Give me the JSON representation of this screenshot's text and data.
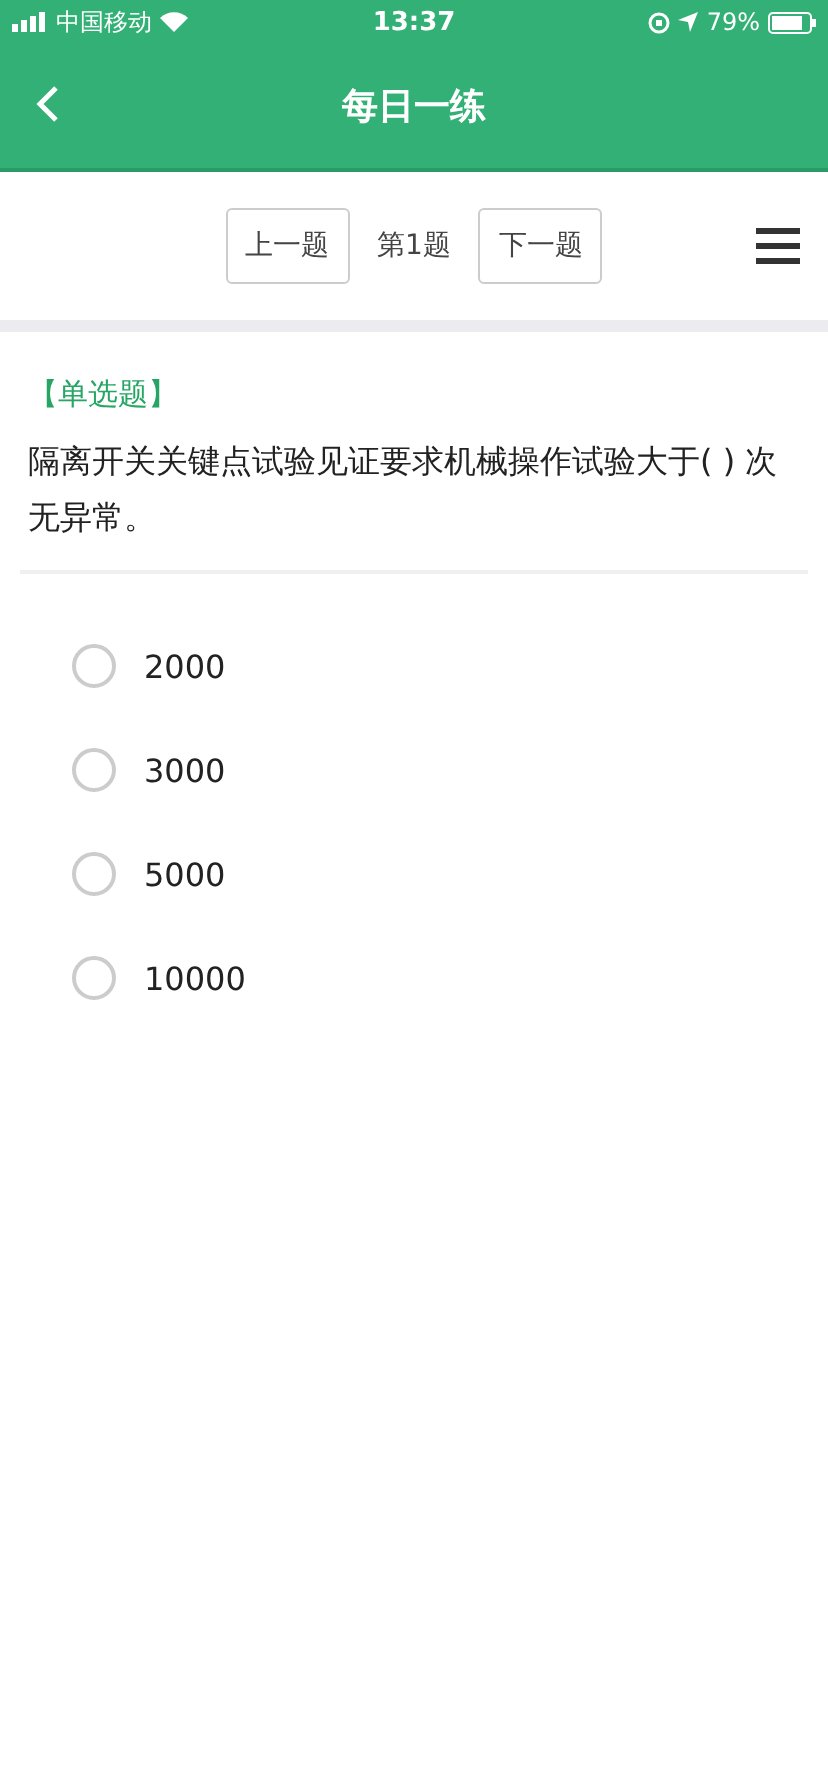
{
  "status_bar": {
    "carrier": "中国移动",
    "time": "13:37",
    "battery": "79%"
  },
  "header": {
    "title": "每日一练"
  },
  "nav": {
    "prev": "上一题",
    "current": "第1题",
    "next": "下一题"
  },
  "question": {
    "type": "【单选题】",
    "text": " 隔离开关关键点试验见证要求机械操作试验大于( ) 次无异常。"
  },
  "options": [
    {
      "label": "2000",
      "selected": false
    },
    {
      "label": "3000",
      "selected": false
    },
    {
      "label": "5000",
      "selected": false
    },
    {
      "label": "10000",
      "selected": false
    }
  ]
}
